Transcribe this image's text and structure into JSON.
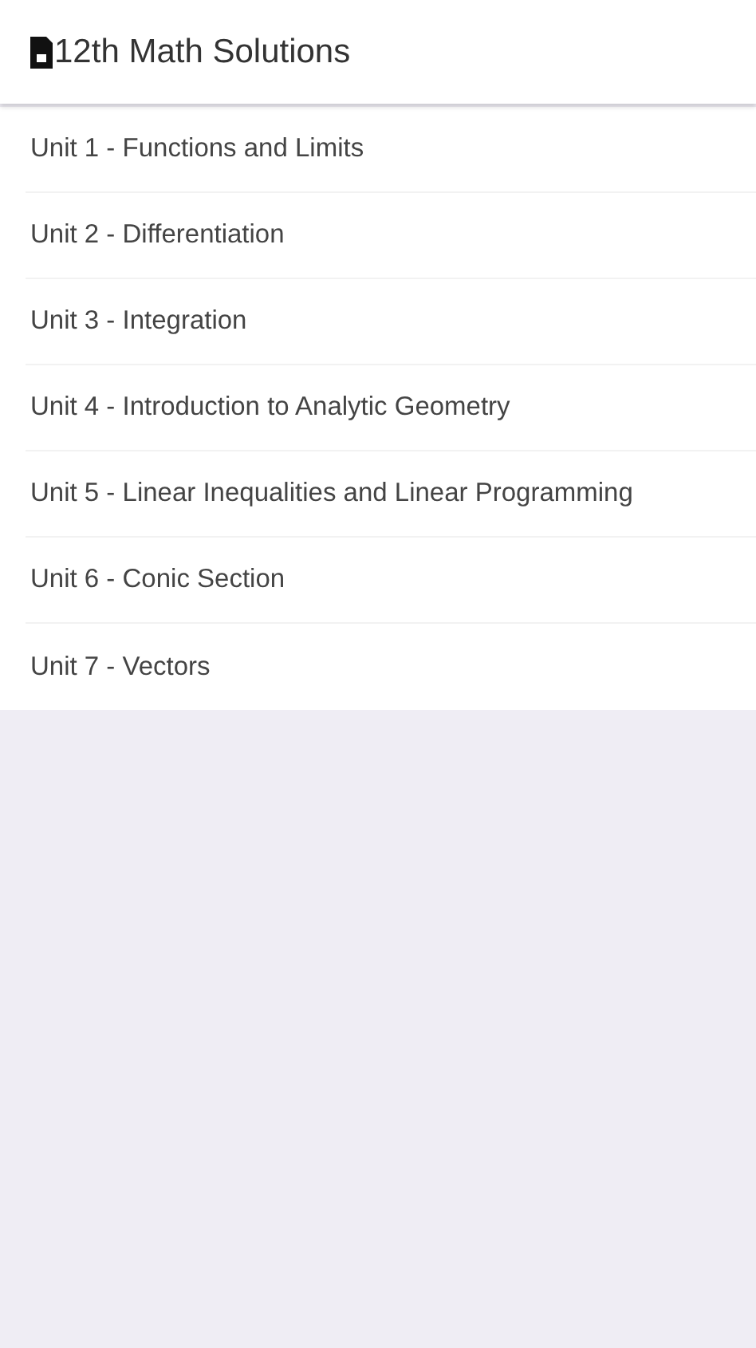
{
  "header": {
    "title": "12th Math Solutions"
  },
  "units": [
    {
      "label": "Unit 1 - Functions and Limits"
    },
    {
      "label": "Unit 2 - Differentiation"
    },
    {
      "label": "Unit 3 - Integration"
    },
    {
      "label": "Unit 4 - Introduction to Analytic Geometry"
    },
    {
      "label": "Unit 5 - Linear Inequalities and Linear Programming"
    },
    {
      "label": "Unit 6 - Conic Section"
    },
    {
      "label": "Unit 7 - Vectors"
    }
  ]
}
